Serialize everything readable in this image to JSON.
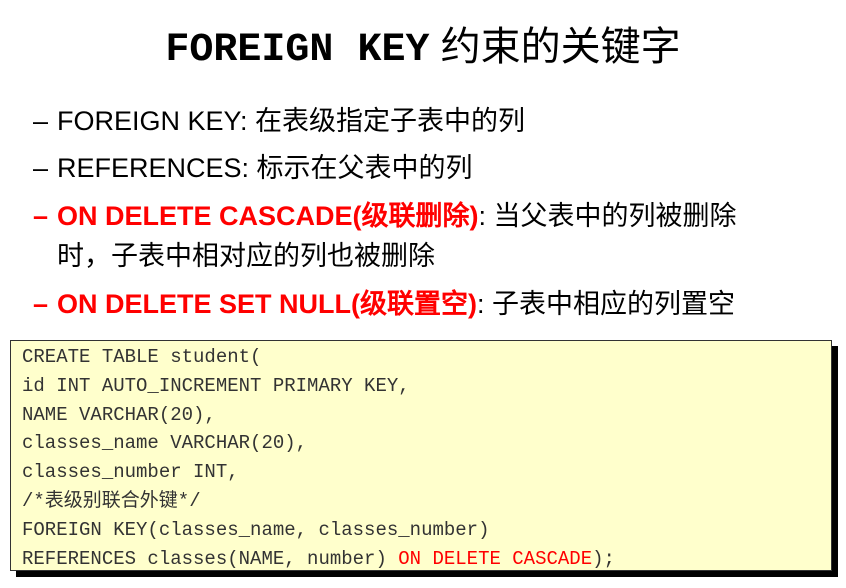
{
  "title": {
    "mono": "FOREIGN KEY",
    "cn": "约束的关键字"
  },
  "bullets": [
    {
      "dash": "–",
      "key": "FOREIGN KEY:",
      "text": " 在表级指定子表中的列"
    },
    {
      "dash": "–",
      "key": "REFERENCES:",
      "text": " 标示在父表中的列"
    },
    {
      "dash": "–",
      "key": "ON DELETE CASCADE(级联删除)",
      "text": ": 当父表中的列被删除",
      "text2": "时，子表中相对应的列也被删除"
    },
    {
      "dash": "–",
      "key": "ON DELETE SET NULL(级联置空)",
      "text": ": 子表中相应的列置空"
    }
  ],
  "code": {
    "lines": [
      "CREATE TABLE student(",
      "id INT AUTO_INCREMENT PRIMARY KEY,",
      "NAME VARCHAR(20),",
      "classes_name VARCHAR(20),",
      "classes_number INT,",
      "/*表级别联合外键*/",
      "FOREIGN KEY(classes_name, classes_number)"
    ],
    "last_prefix": "REFERENCES classes(NAME, number) ",
    "last_red": "ON DELETE CASCADE",
    "last_suffix": ");"
  },
  "colors": {
    "highlight": "#ff0000",
    "code_bg": "#ffffcc"
  }
}
